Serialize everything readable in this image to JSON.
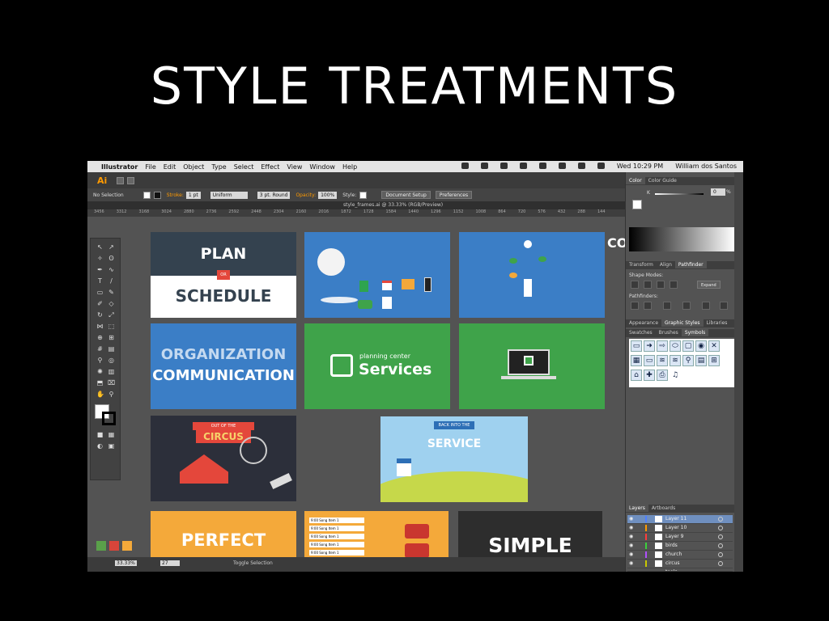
{
  "slide": {
    "title": "STYLE TREATMENTS"
  },
  "menubar": {
    "apple": "",
    "app_name": "Illustrator",
    "items": [
      "File",
      "Edit",
      "Object",
      "Type",
      "Select",
      "Effect",
      "View",
      "Window",
      "Help"
    ],
    "clock": "Wed 10:29 PM",
    "user": "William dos Santos"
  },
  "app": {
    "logo": "Ai"
  },
  "control_bar": {
    "selection": "No Selection",
    "stroke_label": "Stroke:",
    "stroke_value": "1 pt",
    "profile": "Uniform",
    "brush": "3 pt. Round",
    "opacity_label": "Opacity:",
    "opacity_value": "100%",
    "style_label": "Style:",
    "document_setup": "Document Setup",
    "preferences": "Preferences"
  },
  "document": {
    "tab": "style_frames.ai @ 33.33% (RGB/Preview)"
  },
  "ruler": {
    "ticks": [
      "3456",
      "3312",
      "3168",
      "3024",
      "2880",
      "2736",
      "2592",
      "2448",
      "2304",
      "2160",
      "2016",
      "1872",
      "1728",
      "1584",
      "1440",
      "1296",
      "1152",
      "1008",
      "864",
      "720",
      "576",
      "432",
      "288",
      "144"
    ]
  },
  "status_bar": {
    "zoom": "33.33%",
    "page": "27",
    "tool": "Toggle Selection"
  },
  "artboards": {
    "plan": {
      "top": "PLAN",
      "mid": "OR",
      "bottom": "SCHEDULE"
    },
    "org": {
      "line1": "ORGANIZATION",
      "line2": "COMMUNICATION"
    },
    "services": {
      "small": "planning center",
      "big": "Services"
    },
    "circus": {
      "banner": "OUT OF THE",
      "word": "CIRCUS"
    },
    "service": {
      "ribbon": "BACK INTO THE",
      "word": "SERVICE"
    },
    "perfect": {
      "word": "PERFECT"
    },
    "songs": {
      "times": [
        "9:00",
        "9:00",
        "9:00",
        "9:00",
        "9:00",
        "9:00"
      ],
      "item": "Song Item 1"
    },
    "simple": {
      "word": "SIMPLE"
    },
    "cut_text": "CO"
  },
  "panels": {
    "color_tabs": [
      "Color",
      "Color Guide"
    ],
    "color_value": "0",
    "color_unit": "%",
    "color_channel": "K",
    "pathfinder_tabs": [
      "Transform",
      "Align",
      "Pathfinder"
    ],
    "shape_modes": "Shape Modes:",
    "pathfinders": "Pathfinders:",
    "expand": "Expand",
    "styles_tabs": [
      "Appearance",
      "Graphic Styles",
      "Libraries"
    ],
    "symbol_tabs": [
      "Swatches",
      "Brushes",
      "Symbols"
    ],
    "layers_tabs": [
      "Layers",
      "Artboards"
    ],
    "layers": [
      "Layer 11",
      "Layer 10",
      "Layer 9",
      "birds",
      "church",
      "circus",
      "tools"
    ],
    "layer_colors": [
      "#4f7fff",
      "#ff9a00",
      "#ff3b3b",
      "#3bd13b",
      "#b04fff",
      "#c8c800",
      "#ff5ab0"
    ]
  },
  "colors": {
    "plan_dark": "#34424f",
    "blue": "#3b7ec6",
    "green": "#3fa34a",
    "navy": "#2c2f3a",
    "orange": "#f4a93a",
    "simple_dark": "#2d2d2d",
    "accent_red": "#e4473b"
  }
}
